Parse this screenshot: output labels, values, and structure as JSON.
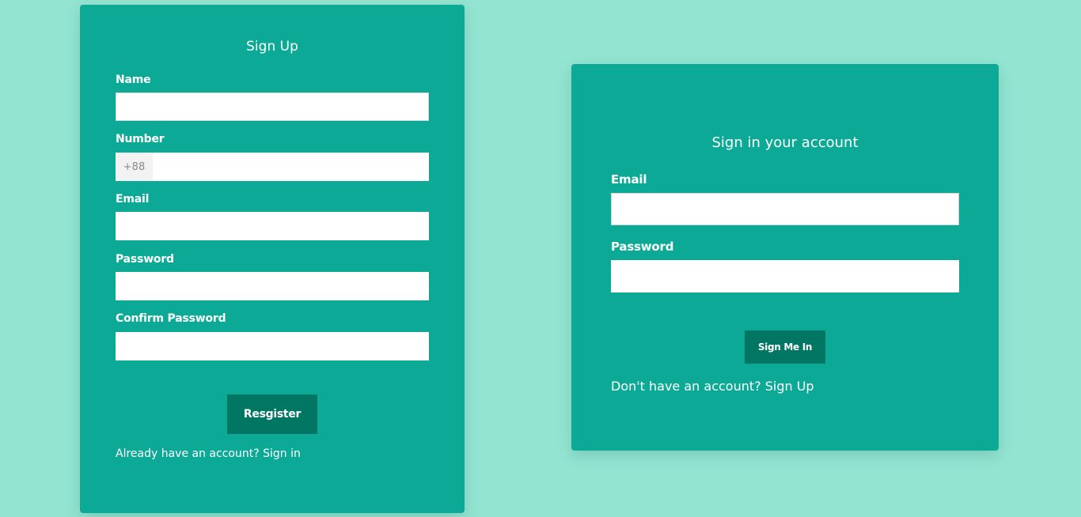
{
  "signup": {
    "title": "Sign Up",
    "fields": {
      "name": {
        "label": "Name",
        "value": ""
      },
      "number": {
        "label": "Number",
        "prefix": "+88",
        "value": ""
      },
      "email": {
        "label": "Email",
        "value": ""
      },
      "password": {
        "label": "Password",
        "value": ""
      },
      "confirm_password": {
        "label": "Confirm Password",
        "value": ""
      }
    },
    "submit_label": "Resgister",
    "footer_text": "Already have an account?",
    "footer_link": "Sign in"
  },
  "signin": {
    "title": "Sign in your account",
    "fields": {
      "email": {
        "label": "Email",
        "value": ""
      },
      "password": {
        "label": "Password",
        "value": ""
      }
    },
    "submit_label": "Sign Me In",
    "footer_text": "Don't have an account?",
    "footer_link": "Sign Up"
  },
  "colors": {
    "background": "#94e4d2",
    "card": "#0caa96",
    "button": "#017763",
    "text": "#ffffff",
    "prefix_bg": "#f2f2f2"
  }
}
